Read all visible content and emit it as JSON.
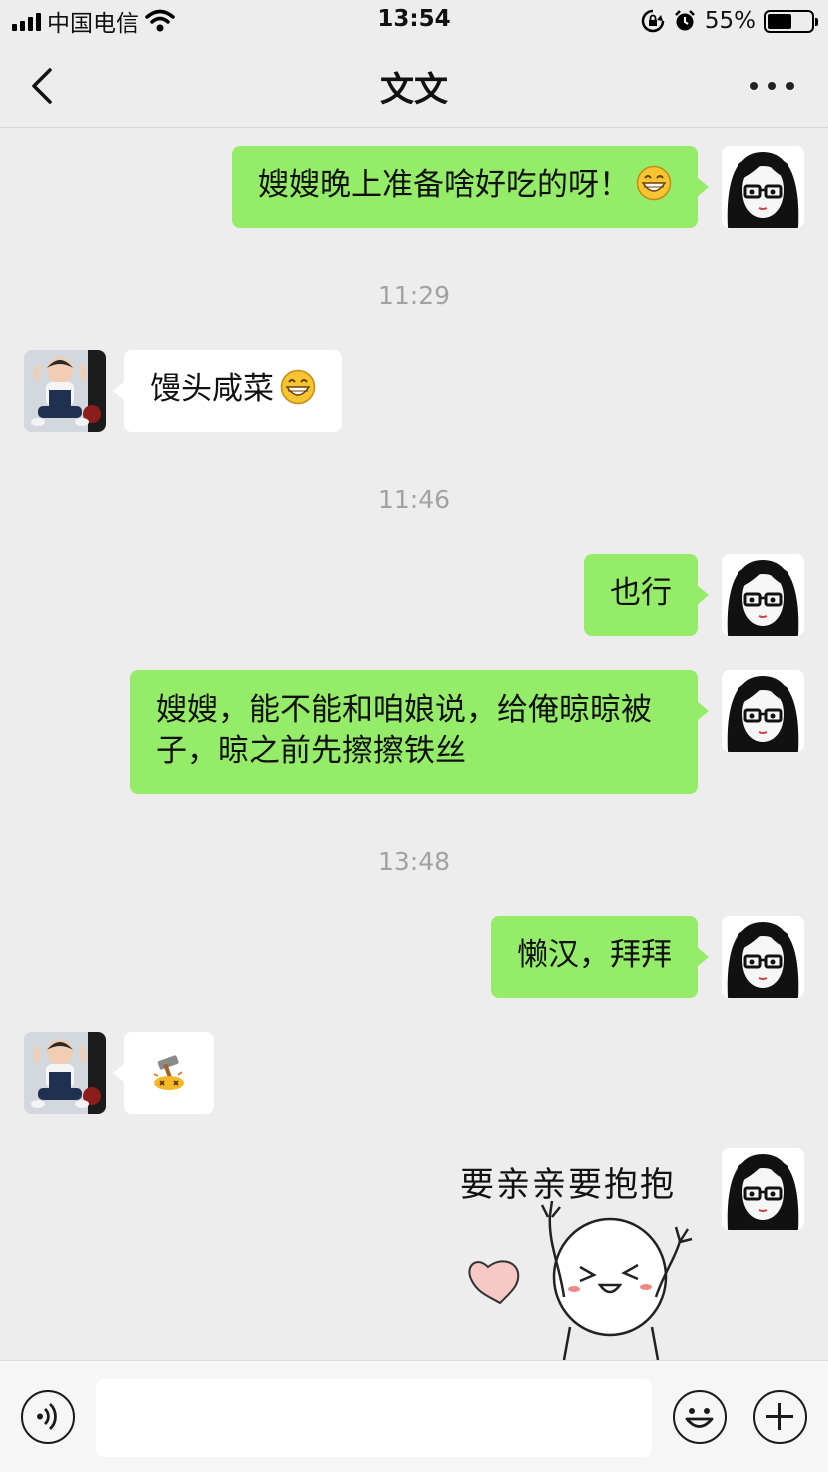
{
  "status_bar": {
    "carrier": "中国电信",
    "time": "13:54",
    "battery_percent": "55%",
    "battery_level": 0.55,
    "icons": [
      "signal-icon",
      "wifi-icon",
      "rotation-lock-icon",
      "alarm-icon",
      "battery-icon"
    ]
  },
  "nav": {
    "title": "文文",
    "back_icon": "chevron-left-icon",
    "more_icon": "more-dots-icon"
  },
  "timestamps": [
    "11:29",
    "11:46",
    "13:48"
  ],
  "messages": [
    {
      "from": "me",
      "text": "嫂嫂晚上准备啥好吃的呀！",
      "emoji": "grin-emoji"
    },
    {
      "from": "other",
      "text": "馒头咸菜",
      "emoji": "grin-emoji"
    },
    {
      "from": "me",
      "text": "也行"
    },
    {
      "from": "me",
      "text": "嫂嫂，能不能和咱娘说，给俺晾晾被子，晾之前先擦擦铁丝"
    },
    {
      "from": "me",
      "text": "懒汉，拜拜"
    },
    {
      "from": "other",
      "emoji": "hammer-emoji"
    },
    {
      "from": "me",
      "sticker_text": "要亲亲要抱抱",
      "sticker": "hug-sticker"
    }
  ],
  "input_bar": {
    "voice_icon": "voice-icon",
    "emoji_icon": "smile-icon",
    "plus_icon": "plus-icon",
    "text_value": ""
  },
  "colors": {
    "background": "#ededed",
    "outgoing_bubble": "#95ec69",
    "incoming_bubble": "#ffffff",
    "timestamp": "#a2a2a2"
  }
}
